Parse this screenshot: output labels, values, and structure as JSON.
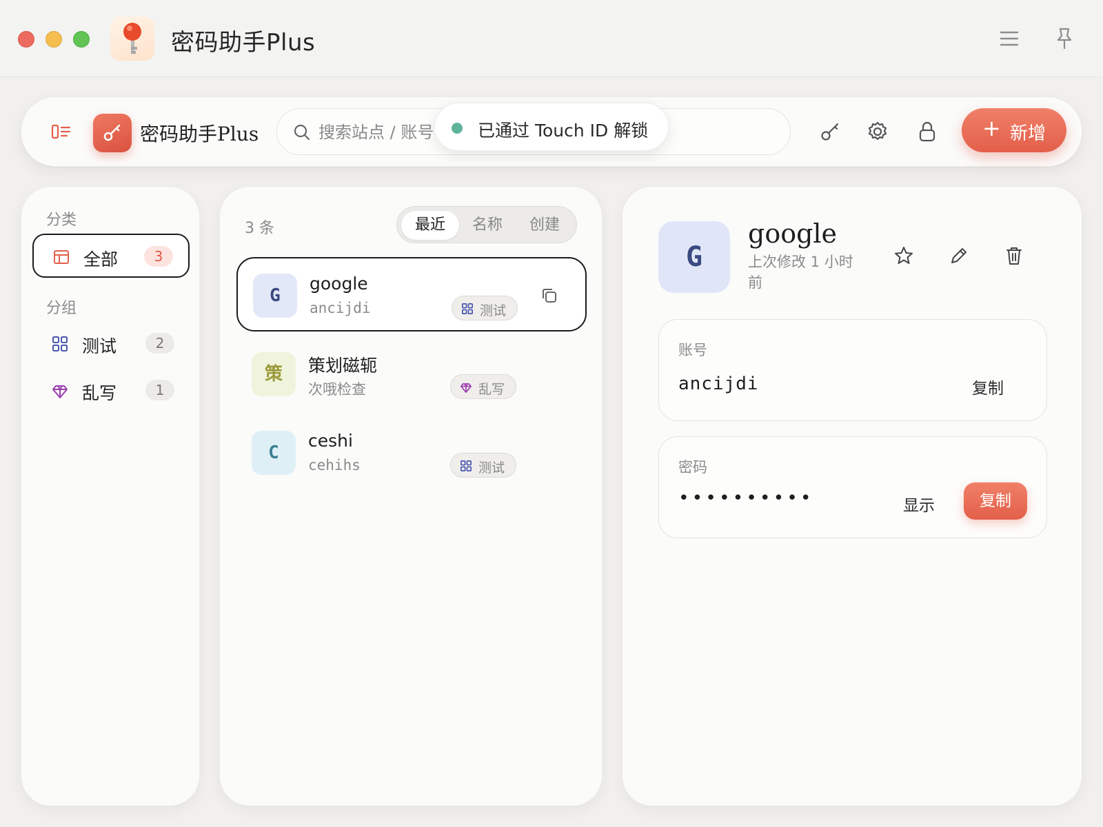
{
  "window": {
    "title": "密码助手Plus"
  },
  "toolbar": {
    "brand": "密码助手Plus",
    "search_placeholder": "搜索站点 / 账号",
    "add_label": "新增",
    "add_plus": "+"
  },
  "toast": {
    "text": "已通过 Touch ID 解锁",
    "dot_color": "#5fb39b"
  },
  "sidebar": {
    "category_heading": "分类",
    "categories": [
      {
        "label": "全部",
        "count": "3",
        "icon": "table-icon"
      }
    ],
    "group_heading": "分组",
    "groups": [
      {
        "label": "测试",
        "count": "2",
        "icon": "grid-icon"
      },
      {
        "label": "乱写",
        "count": "1",
        "icon": "diamond-icon"
      }
    ]
  },
  "list": {
    "count_label": "3 条",
    "sort_tabs": [
      "最近",
      "名称",
      "创建"
    ],
    "active_sort": "最近",
    "entries": [
      {
        "initial": "G",
        "name": "google",
        "account": "ancijdi",
        "tag": "测试",
        "tag_icon": "grid-icon",
        "avatar_bg": "#e3e8f8",
        "avatar_fg": "#3b4a80",
        "selected": true
      },
      {
        "initial": "策",
        "name": "策划磁轭",
        "account": "次哦检查",
        "tag": "乱写",
        "tag_icon": "diamond-icon",
        "avatar_bg": "#f1f4dc",
        "avatar_fg": "#9a9a3a",
        "selected": false
      },
      {
        "initial": "C",
        "name": "ceshi",
        "account": "cehihs",
        "tag": "测试",
        "tag_icon": "grid-icon",
        "avatar_bg": "#def0f6",
        "avatar_fg": "#3f7f95",
        "selected": false
      }
    ]
  },
  "detail": {
    "initial": "G",
    "name": "google",
    "modified": "上次修改 1 小时前",
    "account_label": "账号",
    "account_value": "ancijdi",
    "account_copy": "复制",
    "password_label": "密码",
    "password_mask": "••••••••••",
    "password_show": "显示",
    "password_copy": "复制"
  },
  "colors": {
    "accent": "#e35f4a",
    "accent_light": "#f08068"
  }
}
